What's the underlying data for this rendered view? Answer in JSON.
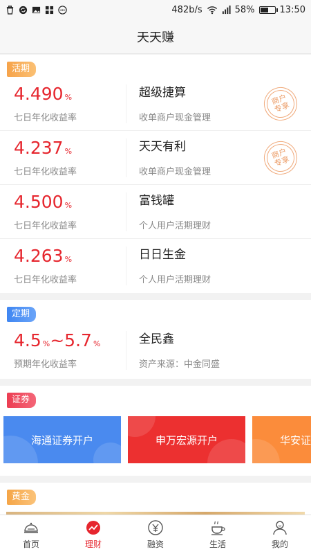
{
  "status": {
    "speed": "482b/s",
    "battery": "58%",
    "battery_level": 0.58,
    "time": "13:50"
  },
  "header": {
    "title": "天天赚"
  },
  "current": {
    "tag": "活期",
    "items": [
      {
        "rate": "4.490",
        "unit": "%",
        "rate_label": "七日年化收益率",
        "name": "超级捷算",
        "desc": "收单商户现金管理",
        "stamp": "商户\n专享"
      },
      {
        "rate": "4.237",
        "unit": "%",
        "rate_label": "七日年化收益率",
        "name": "天天有利",
        "desc": "收单商户现金管理",
        "stamp": "商户\n专享"
      },
      {
        "rate": "4.500",
        "unit": "%",
        "rate_label": "七日年化收益率",
        "name": "富钱罐",
        "desc": "个人用户活期理财"
      },
      {
        "rate": "4.263",
        "unit": "%",
        "rate_label": "七日年化收益率",
        "name": "日日生金",
        "desc": "个人用户活期理财"
      }
    ]
  },
  "fixed": {
    "tag": "定期",
    "item": {
      "rate_low": "4.5",
      "unit": "%",
      "sep": "~",
      "rate_high": "5.7",
      "rate_label": "预期年化收益率",
      "name": "全民鑫",
      "desc": "资产来源：中金同盛"
    }
  },
  "securities": {
    "tag": "证券",
    "cards": [
      {
        "label": "海通证券开户",
        "color": "#4a8aef"
      },
      {
        "label": "申万宏源开户",
        "color": "#ec3030"
      },
      {
        "label": "华安证券开户",
        "color": "#fb8c3b"
      }
    ]
  },
  "gold": {
    "tag": "黄金"
  },
  "tabbar": {
    "tabs": [
      {
        "label": "首页",
        "icon": "home-dome-icon"
      },
      {
        "label": "理财",
        "icon": "finance-chart-icon",
        "active": true
      },
      {
        "label": "融资",
        "icon": "financing-icon"
      },
      {
        "label": "生活",
        "icon": "coffee-cup-icon"
      },
      {
        "label": "我的",
        "icon": "person-icon"
      }
    ]
  },
  "colors": {
    "accent_red": "#e6262e",
    "tag_orange": "#f6a34a",
    "tag_blue": "#3f86f2",
    "tag_red": "#ec3d52"
  }
}
